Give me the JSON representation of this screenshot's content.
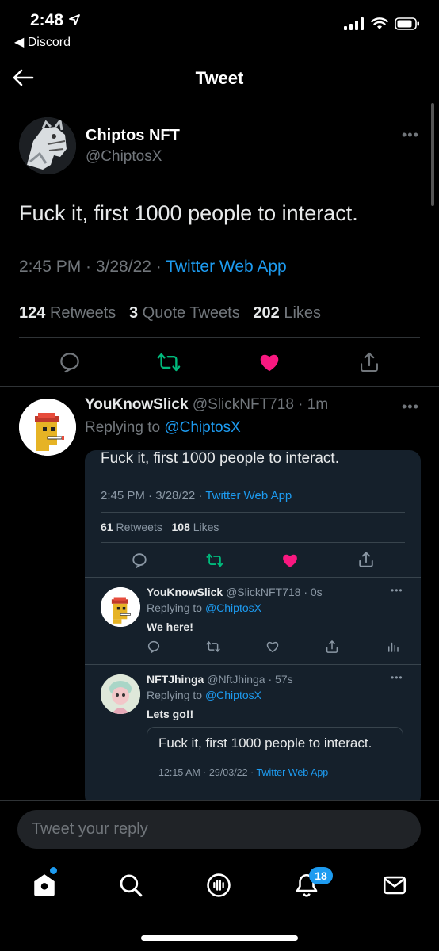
{
  "status_bar": {
    "time": "2:48",
    "back_app": "◀ Discord"
  },
  "header": {
    "title": "Tweet"
  },
  "main_tweet": {
    "name": "Chiptos NFT",
    "handle": "@ChiptosX",
    "text": "Fuck it, first 1000 people to interact.",
    "time": "2:45 PM · 3/28/22 · ",
    "source": "Twitter Web App",
    "retweets": "124",
    "retweets_label": "Retweets",
    "quotes": "3",
    "quotes_label": "Quote Tweets",
    "likes": "202",
    "likes_label": "Likes"
  },
  "reply": {
    "name": "YouKnowSlick",
    "handle": "@SlickNFT718",
    "age": " · 1m",
    "replying_prefix": "Replying to ",
    "replying_to": "@ChiptosX"
  },
  "card": {
    "text": "Fuck it, first 1000 people to interact.",
    "time": "2:45 PM · 3/28/22 · ",
    "source": "Twitter Web App",
    "retweets": "61",
    "retweets_label": "Retweets",
    "likes": "108",
    "likes_label": "Likes",
    "sub_replies": [
      {
        "name": "YouKnowSlick",
        "handle": "@SlickNFT718",
        "age": " · 0s",
        "replying_prefix": "Replying to ",
        "replying_to": "@ChiptosX",
        "text": "We here!"
      },
      {
        "name": "NFTJhinga",
        "handle": "@NftJhinga",
        "age": " · 57s",
        "replying_prefix": "Replying to ",
        "replying_to": "@ChiptosX",
        "text": "Lets go!!"
      }
    ],
    "inner_quote": {
      "text": "Fuck it, first 1000 people to interact.",
      "time": "12:15 AM · 29/03/22 · ",
      "source": "Twitter Web App"
    }
  },
  "composer": {
    "placeholder": "Tweet your reply"
  },
  "tabbar": {
    "notifications_badge": "18"
  },
  "colors": {
    "accent": "#1d9bf0",
    "retweet": "#00ba7c",
    "like": "#f91880",
    "background": "#000000",
    "card": "#15202b"
  }
}
